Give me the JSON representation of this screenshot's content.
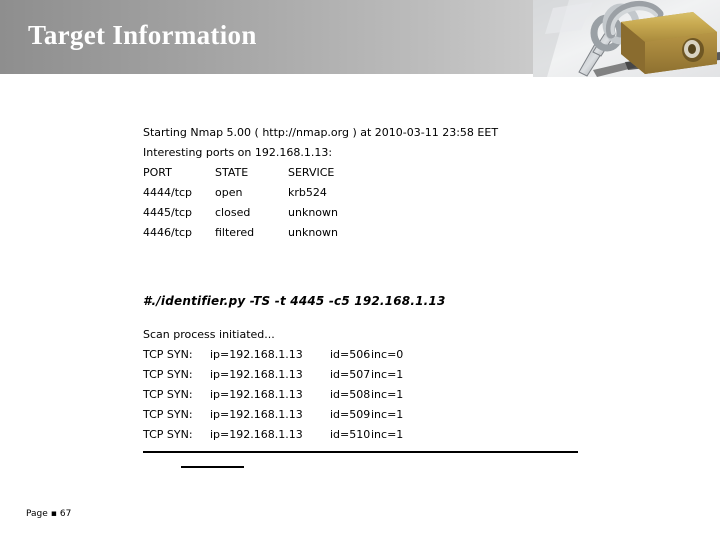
{
  "header": {
    "title": "Target Information",
    "photo_alt": "padlock-and-keys-photo",
    "gradient_from": "#8e8e8e",
    "gradient_to": "#dcdcdc",
    "title_color": "#ffffff"
  },
  "nmap_output": {
    "lines": [
      {
        "c1": "Starting Nmap 5.00 ( http://nmap.org ) at 2010-03-11 23:58 EET"
      },
      {
        "c1": "Interesting ports on 192.168.1.13:"
      },
      {
        "c1": "PORT",
        "c2": "STATE",
        "c3": "SERVICE"
      },
      {
        "c1": "4444/tcp",
        "c2": "open",
        "c3": "krb524"
      },
      {
        "c1": "4445/tcp",
        "c2": "closed",
        "c3": "unknown"
      },
      {
        "c1": "4446/tcp",
        "c2": "filtered",
        "c3": "unknown"
      }
    ]
  },
  "command": "#./identifier.py -TS -t 4445 -c5 192.168.1.13",
  "scan_output": {
    "status": "Scan process initiated...",
    "rows": [
      {
        "label": "TCP SYN:",
        "ip": "ip=192.168.1.13",
        "id": "id=506",
        "inc": "inc=0"
      },
      {
        "label": "TCP SYN:",
        "ip": "ip=192.168.1.13",
        "id": "id=507",
        "inc": "inc=1"
      },
      {
        "label": "TCP SYN:",
        "ip": "ip=192.168.1.13",
        "id": "id=508",
        "inc": "inc=1"
      },
      {
        "label": "TCP SYN:",
        "ip": "ip=192.168.1.13",
        "id": "id=509",
        "inc": "inc=1"
      },
      {
        "label": "TCP SYN:",
        "ip": "ip=192.168.1.13",
        "id": "id=510",
        "inc": "inc=1"
      }
    ]
  },
  "footer": {
    "page_label": "Page",
    "bullet": "▪",
    "page_number": "67"
  }
}
